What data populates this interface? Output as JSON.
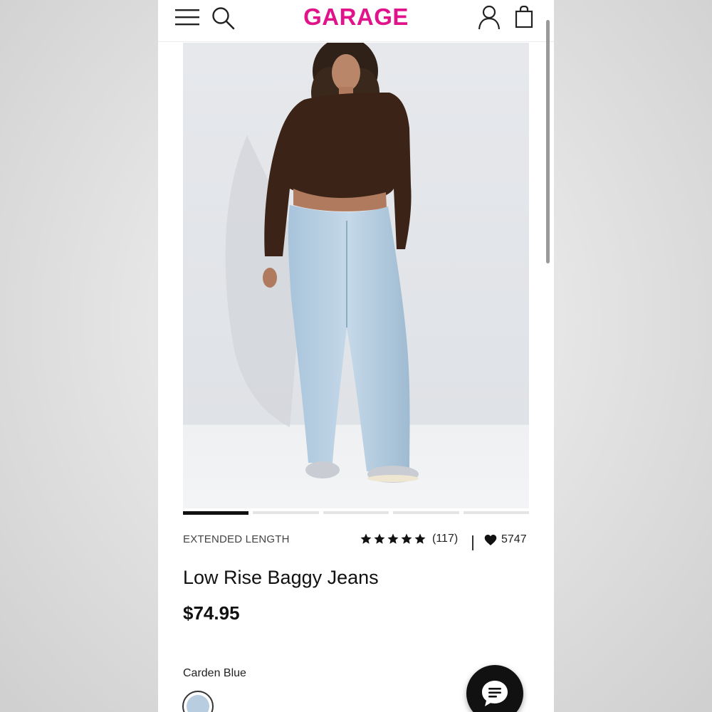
{
  "header": {
    "brand": "GARAGE",
    "brand_color": "#e0138a",
    "icons": [
      "menu-icon",
      "search-icon",
      "account-icon",
      "shopping-bag-icon"
    ]
  },
  "product": {
    "image_alt": "Model wearing low rise baggy jeans and a brown off-shoulder top",
    "carousel": {
      "total": 5,
      "active": 1
    },
    "tag": "EXTENDED LENGTH",
    "rating": {
      "stars": 5,
      "count": "(117)"
    },
    "likes": "5747",
    "title": "Low Rise Baggy Jeans",
    "price": "$74.95",
    "color_name": "Carden Blue",
    "swatch_color": "#b9cde0"
  },
  "chat": {
    "icon": "chat-bubble-icon"
  }
}
